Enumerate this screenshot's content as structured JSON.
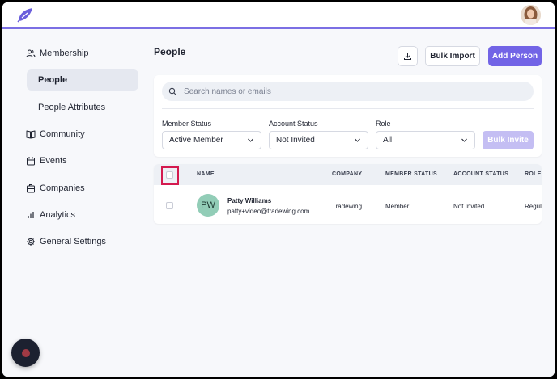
{
  "brand": {
    "logo_icon": "feather-logo-icon",
    "accent_color": "#7264e6"
  },
  "user": {
    "avatar_icon": "user-avatar"
  },
  "sidebar": {
    "items": [
      {
        "label": "Membership",
        "icon": "users-icon"
      },
      {
        "label": "People",
        "active": true
      },
      {
        "label": "People Attributes"
      },
      {
        "label": "Community",
        "icon": "book-icon"
      },
      {
        "label": "Events",
        "icon": "calendar-icon"
      },
      {
        "label": "Companies",
        "icon": "building-icon"
      },
      {
        "label": "Analytics",
        "icon": "bar-chart-icon"
      },
      {
        "label": "General Settings",
        "icon": "gear-icon"
      }
    ]
  },
  "header": {
    "title": "People",
    "download_icon": "download-icon",
    "bulk_import_label": "Bulk Import",
    "add_person_label": "Add Person"
  },
  "filters": {
    "search_placeholder": "Search names or emails",
    "member_status": {
      "label": "Member Status",
      "value": "Active Member"
    },
    "account_status": {
      "label": "Account Status",
      "value": "Not Invited"
    },
    "role": {
      "label": "Role",
      "value": "All"
    },
    "bulk_invite_label": "Bulk Invite"
  },
  "table": {
    "columns": [
      "NAME",
      "COMPANY",
      "MEMBER STATUS",
      "ACCOUNT STATUS",
      "ROLE"
    ],
    "rows": [
      {
        "initials": "PW",
        "name": "Patty Williams",
        "email": "patty+video@tradewing.com",
        "company": "Tradewing",
        "member_status": "Member",
        "account_status": "Not Invited",
        "role": "Regul"
      }
    ]
  }
}
